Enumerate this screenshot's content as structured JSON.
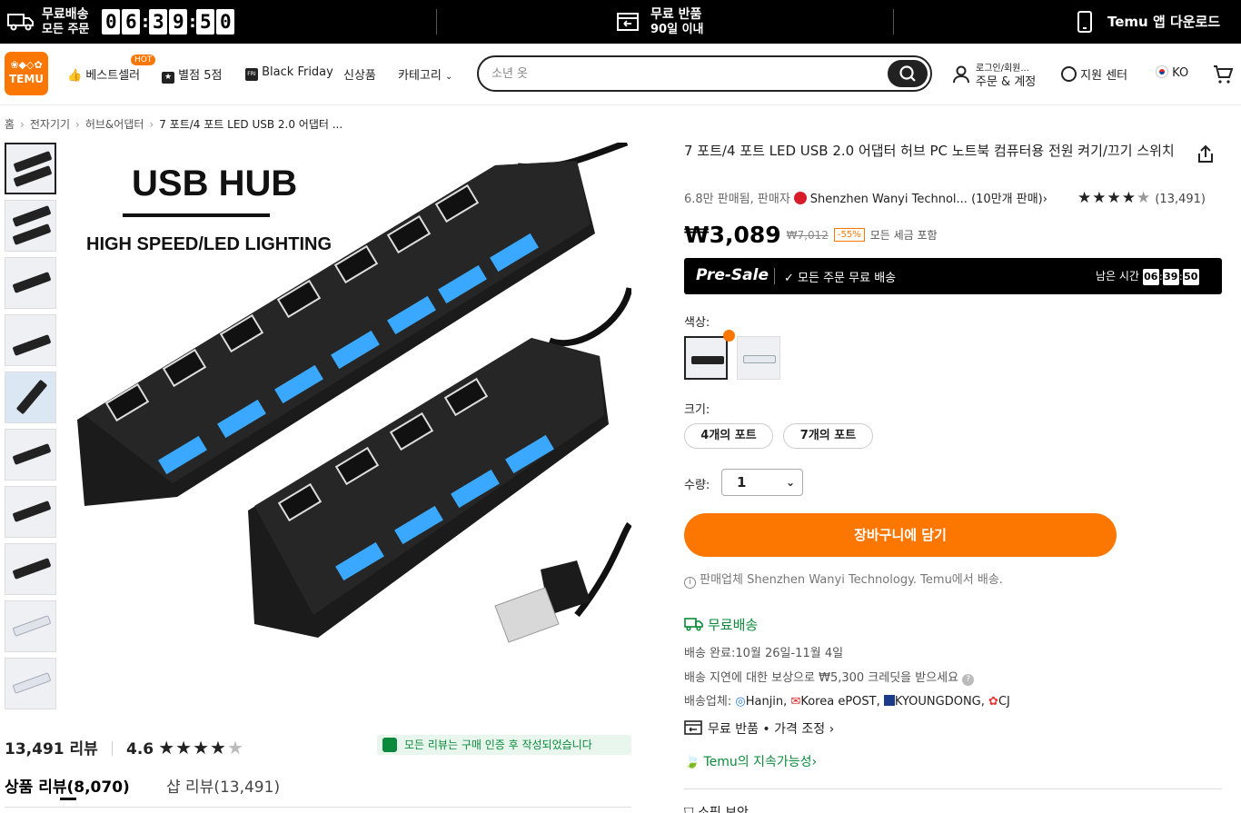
{
  "topbar": {
    "free_shipping_title": "무료배송",
    "free_shipping_sub": "모든 주문",
    "countdown": [
      "0",
      "6",
      "3",
      "9",
      "5",
      "0"
    ],
    "free_return_title": "무료 반품",
    "free_return_sub": "90일 이내",
    "app_download": "Temu 앱 다운로드"
  },
  "header": {
    "logo_text": "TEMU",
    "nav": {
      "bestseller": "베스트셀러",
      "hot_badge": "HOT",
      "five_star": "별점 5점",
      "black_friday": "Black Friday",
      "new_arrivals": "신상품",
      "category": "카테고리"
    },
    "search_placeholder": "소년 옷",
    "account_top": "로그인/회원...",
    "account_bottom": "주문 & 계정",
    "support": "지원 센터",
    "language": "KO"
  },
  "breadcrumb": [
    "홈",
    "전자기기",
    "허브&어댑터",
    "7 포트/4 포트 LED USB 2.0 어댑터 ..."
  ],
  "product": {
    "image_text_main": "USB HUB",
    "image_text_sub": "HIGH SPEED/LED LIGHTING",
    "title": "7 포트/4 포트 LED USB 2.0 어댑터 허브 PC 노트북 컴퓨터용 전원 켜기/끄기 스위치",
    "sold": "6.8만 판매됨, 판매자",
    "seller_name": "Shenzhen Wanyi Technol...",
    "seller_sales": "(10만개 판매)",
    "rating_stars": 4.6,
    "rating_count": "(13,491)",
    "price": "₩3,089",
    "original_price": "₩7,012",
    "discount": "-55%",
    "tax_note": "모든 세금 포함",
    "presale_label": "Pre-Sale",
    "presale_shipping": "모든 주문 무료 배송",
    "remaining_label": "남은 시간",
    "remaining": [
      "06",
      "39",
      "50"
    ],
    "color_label": "색상:",
    "size_label": "크기:",
    "sizes": [
      "4개의 포트",
      "7개의 포트"
    ],
    "qty_label": "수량:",
    "qty_value": "1",
    "add_to_cart": "장바구니에 담기",
    "seller_note": "판매업체 Shenzhen Wanyi Technology. Temu에서 배송.",
    "free_delivery": "무료배송",
    "delivery_done": "배송 완료:10월 26일-11월 4일",
    "delay_credit": "배송 지연에 대한 보상으로 ₩5,300 크레딧을 받으세요",
    "carriers_label": "배송업체:",
    "carriers": [
      "Hanjin,",
      "Korea ePOST,",
      "KYOUNGDONG,",
      "CJ"
    ],
    "return_row": "무료 반품 • 가격 조정",
    "sustainability": "Temu의 지속가능성",
    "next_section": "소핑 보안"
  },
  "reviews": {
    "count": "13,491 리뷰",
    "score": "4.6",
    "verified_note": "모든 리뷰는 구매 인증 후 작성되었습니다",
    "tab_product": "상품 리뷰(8,070)",
    "tab_shop": "샵 리뷰(13,491)"
  },
  "colors": {
    "accent": "#fb7701",
    "green": "#0a8a3a",
    "led_blue": "#3aa8ff"
  }
}
